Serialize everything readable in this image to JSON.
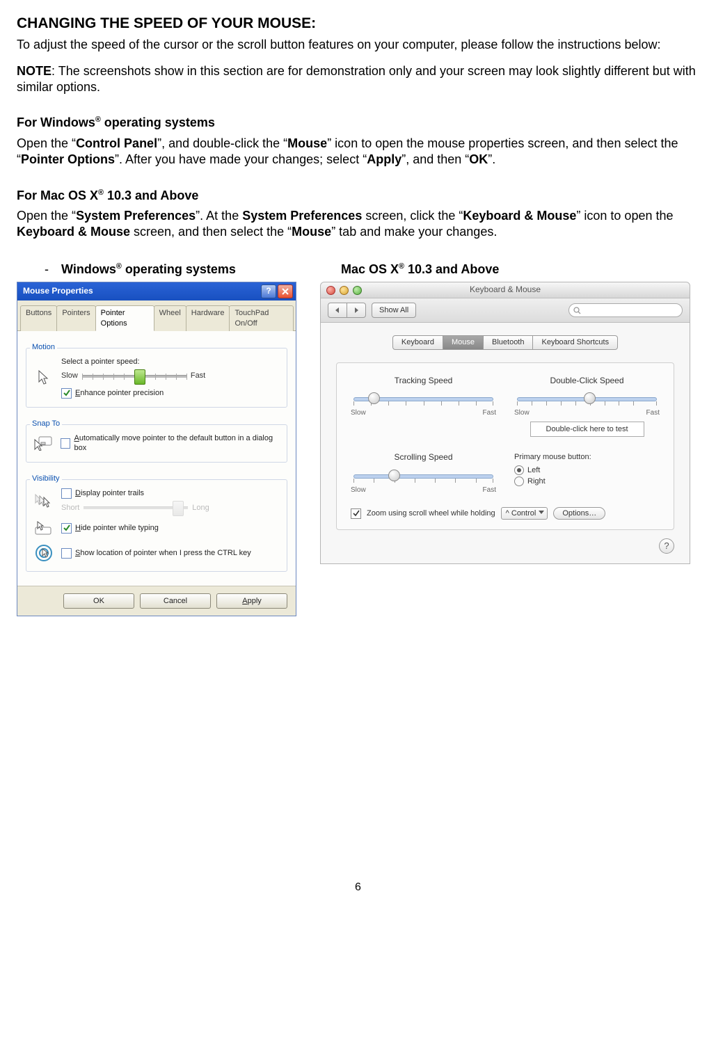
{
  "doc": {
    "title": "CHANGING THE SPEED OF YOUR MOUSE:",
    "intro": "To adjust the speed of the cursor or the scroll button features on your computer, please follow the instructions below:",
    "note_label": "NOTE",
    "note": ": The screenshots show in this section are for demonstration only and your screen may look slightly different but with similar options.",
    "win_heading_pre": "For Windows",
    "win_heading_post": " operating systems",
    "win_para_1a": "Open the “",
    "win_para_cp": "Control Panel",
    "win_para_1b": "”, and double-click the “",
    "win_para_mouse": "Mouse",
    "win_para_1c": "” icon to open the mouse properties screen, and then select the “",
    "win_para_po": "Pointer Options",
    "win_para_1d": "”. After you have made your changes; select “",
    "win_para_apply": "Apply",
    "win_para_1e": "”, and then “",
    "win_para_ok": "OK",
    "win_para_1f": "”.",
    "mac_heading_pre": "For Mac OS X",
    "mac_heading_post": " 10.3 and Above",
    "mac_para_a": "Open the “",
    "mac_para_sp": "System Preferences",
    "mac_para_b": "”. At the ",
    "mac_para_sp2": "System Preferences",
    "mac_para_c": " screen, click the “",
    "mac_para_km": "Keyboard & Mouse",
    "mac_para_d": "” icon to open the ",
    "mac_para_km2": "Keyboard & Mouse",
    "mac_para_e": " screen, and then select the “",
    "mac_para_mousetab": "Mouse",
    "mac_para_f": "” tab and make your changes.",
    "caption_win_dash": "-",
    "caption_win_pre": "Windows",
    "caption_win_post": " operating systems",
    "caption_mac_pre": "Mac OS X",
    "caption_mac_post": " 10.3 and Above",
    "reg": "®",
    "page_number": "6"
  },
  "win": {
    "title": "Mouse Properties",
    "tabs": [
      "Buttons",
      "Pointers",
      "Pointer Options",
      "Wheel",
      "Hardware",
      "TouchPad On/Off"
    ],
    "active_tab_index": 2,
    "motion": {
      "group": "Motion",
      "label": "Select a pointer speed:",
      "slow": "Slow",
      "fast": "Fast",
      "enhance_pre": "E",
      "enhance_post": "nhance pointer precision"
    },
    "snap": {
      "group": "Snap To",
      "pre": "A",
      "text": "utomatically move pointer to the default button in a dialog box"
    },
    "visibility": {
      "group": "Visibility",
      "trails_pre": "D",
      "trails_post": "isplay pointer trails",
      "short": "Short",
      "long": "Long",
      "hide_pre": "H",
      "hide_post": "ide pointer while typing",
      "show_pre": "S",
      "show_post": "how location of pointer when I press the CTRL key"
    },
    "buttons": {
      "ok": "OK",
      "cancel": "Cancel",
      "apply_pre": "A",
      "apply_post": "pply"
    }
  },
  "mac": {
    "title": "Keyboard & Mouse",
    "showall": "Show All",
    "tabs": [
      "Keyboard",
      "Mouse",
      "Bluetooth",
      "Keyboard Shortcuts"
    ],
    "active_tab_index": 1,
    "tracking": "Tracking Speed",
    "doubleclick": "Double-Click Speed",
    "scrolling": "Scrolling Speed",
    "slow": "Slow",
    "fast": "Fast",
    "testbox": "Double-click here to test",
    "primary_label": "Primary mouse button:",
    "left": "Left",
    "right": "Right",
    "zoom_label": "Zoom using scroll wheel while holding",
    "control": "^ Control",
    "options": "Options…",
    "help": "?"
  }
}
